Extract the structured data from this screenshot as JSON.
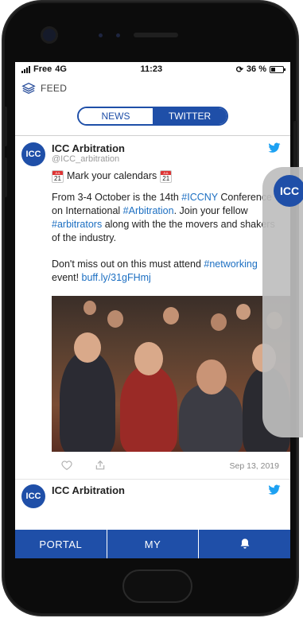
{
  "status_bar": {
    "carrier": "Free",
    "network": "4G",
    "time": "11:23",
    "battery_percent": "36 %"
  },
  "header": {
    "section_icon": "layers-icon",
    "title": "FEED"
  },
  "tabs": [
    {
      "label": "NEWS",
      "active": false
    },
    {
      "label": "TWITTER",
      "active": true
    }
  ],
  "tweets": [
    {
      "author": "ICC Arbitration",
      "handle": "@ICC_arbitration",
      "avatar_text": "ICC",
      "line1": "Mark your calendars",
      "line2_parts": [
        "From 3-4 October is the 14th ",
        "#ICCNY",
        " Conference on International ",
        "#Arbitration",
        ". Join your fellow ",
        "#arbitrators",
        " along with the the movers and shakers of the industry."
      ],
      "line3_parts": [
        "Don't miss out on this must attend ",
        "#networking",
        " event! ",
        "buff.ly/31gFHmj"
      ],
      "date": "Sep 13, 2019"
    },
    {
      "author": "ICC Arbitration",
      "avatar_text": "ICC"
    }
  ],
  "bottom_nav": [
    {
      "label": "PORTAL"
    },
    {
      "label": "MY"
    },
    {
      "label": "",
      "icon": "bell-icon"
    }
  ],
  "overlay": {
    "avatar_text": "ICC"
  },
  "colors": {
    "brand_blue": "#1f4fa8",
    "link": "#1c6fc2"
  }
}
